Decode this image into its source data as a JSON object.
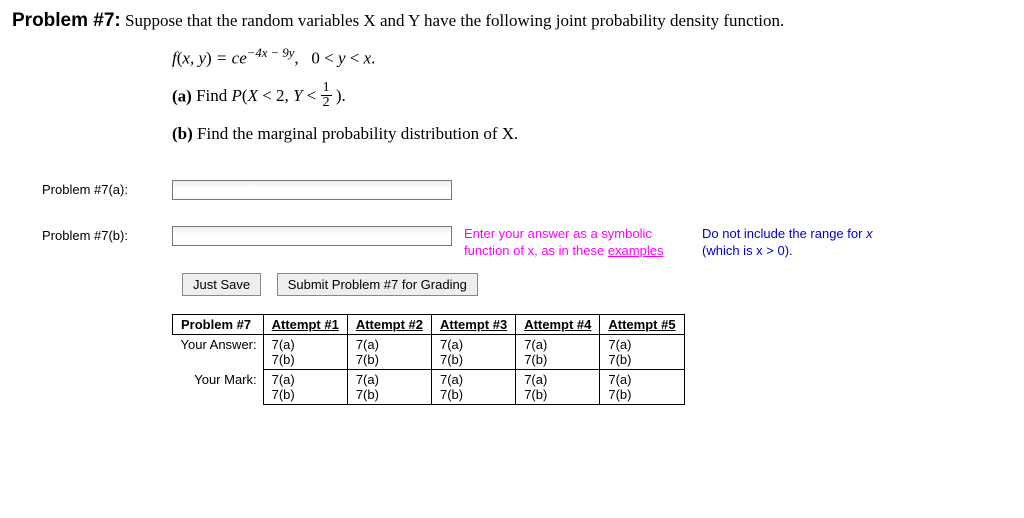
{
  "problem": {
    "heading_label": "Problem #7:",
    "statement": "Suppose that the random variables X and Y have the following joint probability density function.",
    "equation_html": "f(x, y) = ce^{-4x-9y},  0 < y < x.",
    "part_a_label": "(a)",
    "part_a_text": "Find P(X < 2, Y < 1/2).",
    "part_b_label": "(b)",
    "part_b_text": "Find the marginal probability distribution of X."
  },
  "inputs": {
    "a_label": "Problem #7(a):",
    "b_label": "Problem #7(b):",
    "hint_text_1": "Enter your answer as a symbolic function of x, as in these ",
    "hint_examples": "examples",
    "hint2_line1": "Do not include the range for ",
    "hint2_var": "x",
    "hint2_line2": "(which is x > 0)."
  },
  "buttons": {
    "save": "Just Save",
    "submit": "Submit Problem #7 for Grading"
  },
  "attempts": {
    "header": "Problem #7",
    "columns": [
      "Attempt #1",
      "Attempt #2",
      "Attempt #3",
      "Attempt #4",
      "Attempt #5"
    ],
    "rows": [
      {
        "label": "Your Answer:",
        "cells": [
          "7(a)\n7(b)",
          "7(a)\n7(b)",
          "7(a)\n7(b)",
          "7(a)\n7(b)",
          "7(a)\n7(b)"
        ]
      },
      {
        "label": "Your Mark:",
        "cells": [
          "7(a)\n7(b)",
          "7(a)\n7(b)",
          "7(a)\n7(b)",
          "7(a)\n7(b)",
          "7(a)\n7(b)"
        ]
      }
    ]
  }
}
